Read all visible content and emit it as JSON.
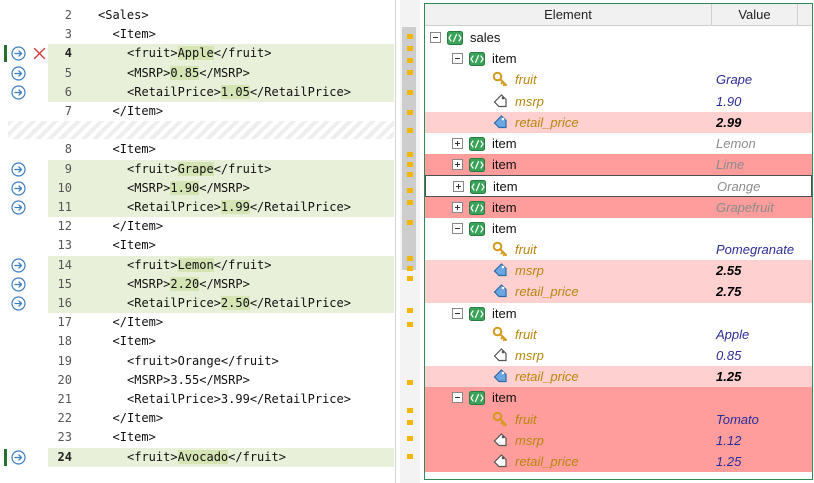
{
  "colors": {
    "changed_line": "#e9f0d9",
    "changed_row": "#ffd0d0",
    "removed_row": "#ff9c9c",
    "accent": "#2e8b57",
    "change_mark": "#f2b705"
  },
  "left_pane": {
    "lines": [
      {
        "num": "2",
        "code": "<Sales>",
        "indent": 0
      },
      {
        "num": "3",
        "code": "<Item>",
        "indent": 1
      },
      {
        "num": "4",
        "code": "<fruit>Apple</fruit>",
        "indent": 2,
        "changed": true,
        "current": true,
        "action": "copy-right-icon",
        "delete": true,
        "hl": "Apple",
        "hl_prefix": "<fruit>",
        "hl_suffix": "</fruit>"
      },
      {
        "num": "5",
        "code": "<MSRP>0.85</MSRP>",
        "indent": 2,
        "changed": true,
        "action": "copy-right-icon",
        "hl": "0.85",
        "hl_prefix": "<MSRP>",
        "hl_suffix": "</MSRP>"
      },
      {
        "num": "6",
        "code": "<RetailPrice>1.05</RetailPrice>",
        "indent": 2,
        "changed": true,
        "action": "copy-right-icon",
        "hl": "1.05",
        "hl_prefix": "<RetailPrice>",
        "hl_suffix": "</RetailPrice>"
      },
      {
        "num": "7",
        "code": "</Item>",
        "indent": 1
      },
      {
        "gap": true
      },
      {
        "num": "8",
        "code": "<Item>",
        "indent": 1
      },
      {
        "num": "9",
        "code": "<fruit>Grape</fruit>",
        "indent": 2,
        "changed": true,
        "action": "copy-right-icon",
        "hl": "Grape",
        "hl_prefix": "<fruit>",
        "hl_suffix": "</fruit>"
      },
      {
        "num": "10",
        "code": "<MSRP>1.90</MSRP>",
        "indent": 2,
        "changed": true,
        "action": "copy-right-icon",
        "hl": "1.90",
        "hl_prefix": "<MSRP>",
        "hl_suffix": "</MSRP>"
      },
      {
        "num": "11",
        "code": "<RetailPrice>1.99</RetailPrice>",
        "indent": 2,
        "changed": true,
        "action": "copy-right-icon",
        "hl": "1.99",
        "hl_prefix": "<RetailPrice>",
        "hl_suffix": "</RetailPrice>"
      },
      {
        "num": "12",
        "code": "</Item>",
        "indent": 1
      },
      {
        "num": "13",
        "code": "<Item>",
        "indent": 1
      },
      {
        "num": "14",
        "code": "<fruit>Lemon</fruit>",
        "indent": 2,
        "changed": true,
        "action": "copy-right-icon",
        "hl": "Lemon",
        "hl_prefix": "<fruit>",
        "hl_suffix": "</fruit>"
      },
      {
        "num": "15",
        "code": "<MSRP>2.20</MSRP>",
        "indent": 2,
        "changed": true,
        "action": "copy-right-icon",
        "hl": "2.20",
        "hl_prefix": "<MSRP>",
        "hl_suffix": "</MSRP>"
      },
      {
        "num": "16",
        "code": "<RetailPrice>2.50</RetailPrice>",
        "indent": 2,
        "changed": true,
        "action": "copy-right-icon",
        "hl": "2.50",
        "hl_prefix": "<RetailPrice>",
        "hl_suffix": "</RetailPrice>"
      },
      {
        "num": "17",
        "code": "</Item>",
        "indent": 1
      },
      {
        "num": "18",
        "code": "<Item>",
        "indent": 1
      },
      {
        "num": "19",
        "code": "<fruit>Orange</fruit>",
        "indent": 2
      },
      {
        "num": "20",
        "code": "<MSRP>3.55</MSRP>",
        "indent": 2
      },
      {
        "num": "21",
        "code": "<RetailPrice>3.99</RetailPrice>",
        "indent": 2
      },
      {
        "num": "22",
        "code": "</Item>",
        "indent": 1
      },
      {
        "num": "23",
        "code": "<Item>",
        "indent": 1
      },
      {
        "num": "24",
        "code": "<fruit>Avocado</fruit>",
        "indent": 2,
        "changed": true,
        "current": true,
        "action": "copy-right-icon",
        "hl": "Avocado",
        "hl_prefix": "<fruit>",
        "hl_suffix": "</fruit>"
      }
    ]
  },
  "right_pane": {
    "header": {
      "element": "Element",
      "value": "Value"
    },
    "rows": [
      {
        "depth": 0,
        "kind": "element",
        "expander": "minus",
        "label": "sales",
        "value": "",
        "style": ""
      },
      {
        "depth": 1,
        "kind": "element",
        "expander": "minus",
        "label": "item",
        "value": "",
        "style": ""
      },
      {
        "depth": 2,
        "kind": "key",
        "label": "fruit",
        "value": "Grape",
        "style": ""
      },
      {
        "depth": 2,
        "kind": "tag",
        "label": "msrp",
        "value": "1.90",
        "style": ""
      },
      {
        "depth": 2,
        "kind": "tag-filled",
        "label": "retail_price",
        "value": "2.99",
        "style": "pink",
        "bold": true
      },
      {
        "depth": 1,
        "kind": "element",
        "expander": "plus",
        "label": "item",
        "value": "Lemon",
        "style": "",
        "gray": true
      },
      {
        "depth": 1,
        "kind": "element",
        "expander": "plus",
        "label": "item",
        "value": "Lime",
        "style": "red",
        "gray": true
      },
      {
        "depth": 1,
        "kind": "element",
        "expander": "plus",
        "label": "item",
        "value": "Orange",
        "style": "selected",
        "gray": true
      },
      {
        "depth": 1,
        "kind": "element",
        "expander": "plus",
        "label": "item",
        "value": "Grapefruit",
        "style": "red",
        "gray": true
      },
      {
        "depth": 1,
        "kind": "element",
        "expander": "minus",
        "label": "item",
        "value": "",
        "style": ""
      },
      {
        "depth": 2,
        "kind": "key",
        "label": "fruit",
        "value": "Pomegranate",
        "style": ""
      },
      {
        "depth": 2,
        "kind": "tag-filled",
        "label": "msrp",
        "value": "2.55",
        "style": "pink",
        "bold": true
      },
      {
        "depth": 2,
        "kind": "tag-filled",
        "label": "retail_price",
        "value": "2.75",
        "style": "pink",
        "bold": true
      },
      {
        "depth": 1,
        "kind": "element",
        "expander": "minus",
        "label": "item",
        "value": "",
        "style": ""
      },
      {
        "depth": 2,
        "kind": "key",
        "label": "fruit",
        "value": "Apple",
        "style": ""
      },
      {
        "depth": 2,
        "kind": "tag",
        "label": "msrp",
        "value": "0.85",
        "style": ""
      },
      {
        "depth": 2,
        "kind": "tag-filled",
        "label": "retail_price",
        "value": "1.25",
        "style": "pink",
        "bold": true
      },
      {
        "depth": 1,
        "kind": "element",
        "expander": "minus",
        "label": "item",
        "value": "",
        "style": "red"
      },
      {
        "depth": 2,
        "kind": "key",
        "label": "fruit",
        "value": "Tomato",
        "style": "red"
      },
      {
        "depth": 2,
        "kind": "tag",
        "label": "msrp",
        "value": "1.12",
        "style": "red"
      },
      {
        "depth": 2,
        "kind": "tag",
        "label": "retail_price",
        "value": "1.25",
        "style": "red"
      }
    ]
  }
}
